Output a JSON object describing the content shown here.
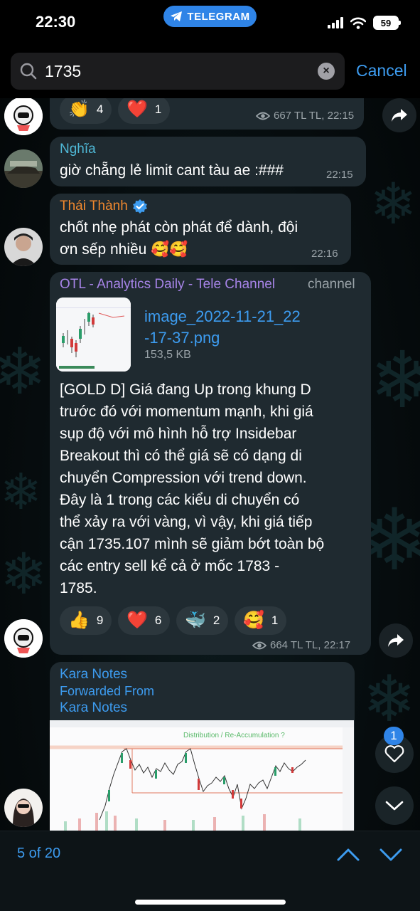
{
  "status_bar": {
    "time": "22:30",
    "app_pill": "TELEGRAM",
    "battery": "59"
  },
  "search": {
    "value": "1735",
    "cancel_label": "Cancel"
  },
  "messages": [
    {
      "reactions": [
        {
          "emoji": "👏",
          "count": "4"
        },
        {
          "emoji": "❤️",
          "count": "1"
        }
      ],
      "views": "667 TL TL, 22:15"
    },
    {
      "sender": "Nghĩa",
      "text": "giờ chẵng lẻ limit cant tàu ae :###",
      "time": "22:15"
    },
    {
      "sender": "Thái Thành",
      "text_line1": "chốt nhẹ phát còn phát để dành, đội",
      "text_line2": "ơn sếp nhiều 🥰🥰",
      "time": "22:16"
    },
    {
      "sender": "OTL - Analytics Daily - Tele Channel",
      "tag": "channel",
      "file_name_line1": "image_2022-11-21_22",
      "file_name_line2": "-17-37.png",
      "file_size": "153,5 KB",
      "text_lines": [
        "[GOLD D] Giá đang Up trong khung D",
        "trước đó với momentum mạnh, khi giá",
        "sụp độ với mô hình hỗ trợ Insidebar",
        "Breakout thì có thể giá sẽ có dạng di",
        "chuyển Compression với trend down.",
        "Đây là 1 trong các kiểu di chuyển có",
        "thể xảy ra với vàng, vì vậy, khi giá tiếp",
        "cận 1735.107 mình sẽ giảm bớt toàn bộ",
        "các entry sell kể cả ở mốc 1783  -",
        "1785."
      ],
      "reactions": [
        {
          "emoji": "👍",
          "count": "9"
        },
        {
          "emoji": "❤️",
          "count": "6"
        },
        {
          "emoji": "🐳",
          "count": "2"
        },
        {
          "emoji": "🥰",
          "count": "1"
        }
      ],
      "views": "664 TL TL, 22:17"
    },
    {
      "sender": "Kara Notes",
      "forwarded_label": "Forwarded From",
      "forwarded_from": "Kara Notes",
      "chart_caption": "Distribution / Re-Accumulation ?"
    }
  ],
  "floating": {
    "reaction_badge": "1"
  },
  "bottom": {
    "result_count": "5 of 20"
  },
  "colors": {
    "accent": "#3d9cf0",
    "bubble": "#1f2a30",
    "nghia_name": "#4fb8d6",
    "thai_name": "#f0882e",
    "otl_name": "#a784e8"
  },
  "icons": [
    "search-icon",
    "clear-icon",
    "eye-icon",
    "share-icon",
    "verified-icon",
    "heart-icon",
    "chevron-down-icon",
    "chevron-up-icon",
    "wifi-icon",
    "signal-icon",
    "telegram-icon"
  ]
}
